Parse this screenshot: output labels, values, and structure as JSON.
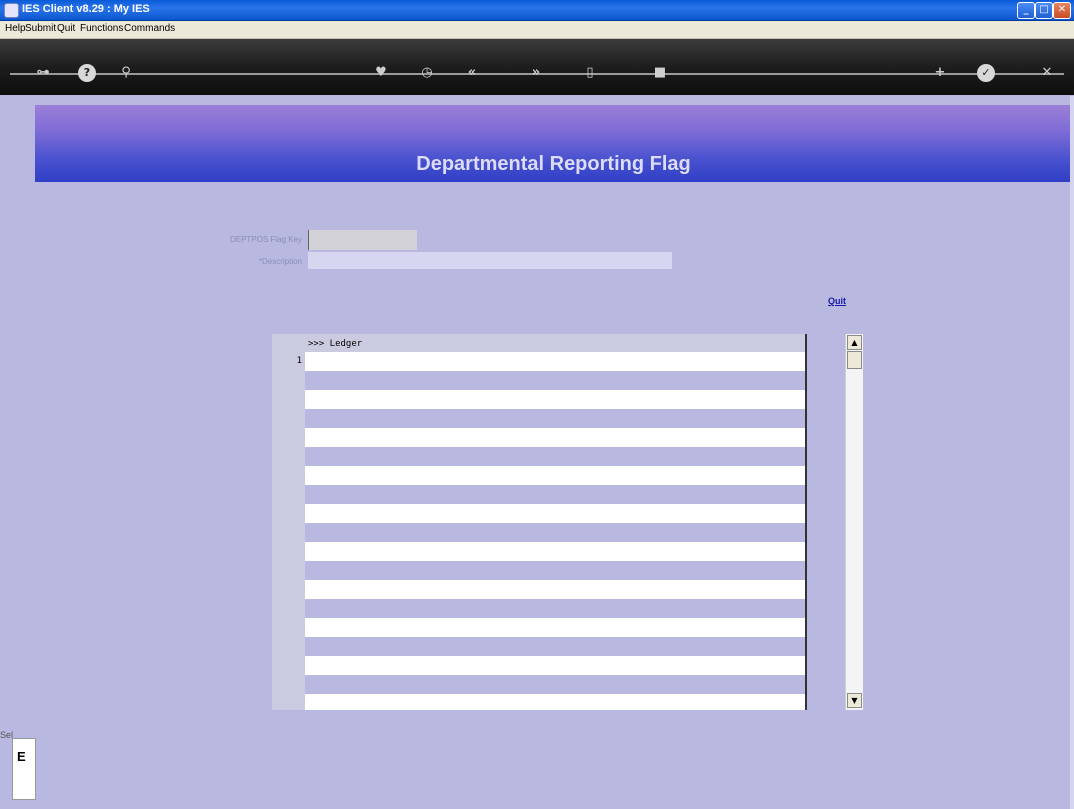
{
  "window": {
    "title": "IES Client v8.29 : My IES",
    "minimize": "_",
    "maximize": "□",
    "close": "✕"
  },
  "menu": {
    "items": [
      "Help",
      "Submit",
      "Quit",
      "Functions",
      "Commands"
    ]
  },
  "toolbar": {
    "icons": [
      {
        "name": "key-icon",
        "glyph": "⊶"
      },
      {
        "name": "help-icon",
        "glyph": "?"
      },
      {
        "name": "search-icon",
        "glyph": "⚲"
      },
      {
        "name": "heart-icon",
        "glyph": "♥"
      },
      {
        "name": "clock-icon",
        "glyph": "◷"
      },
      {
        "name": "rewind-icon",
        "glyph": "«"
      },
      {
        "name": "forward-icon",
        "glyph": "»"
      },
      {
        "name": "document-icon",
        "glyph": "▯"
      },
      {
        "name": "stop-icon",
        "glyph": "■"
      },
      {
        "name": "add-icon",
        "glyph": "+"
      },
      {
        "name": "check-icon",
        "glyph": "✓"
      },
      {
        "name": "cancel-icon",
        "glyph": "✕"
      }
    ]
  },
  "banner": {
    "title": "Departmental Reporting Flag"
  },
  "form": {
    "key_label": "DEPTPOS Flag Key",
    "key_value": "",
    "description_label": "*Description",
    "description_value": "",
    "quit_link": "Quit"
  },
  "grid": {
    "header": ">>> Ledger",
    "row_number": "1"
  },
  "footer": {
    "side_tab": "Sel",
    "side_letter": "E"
  },
  "colors": {
    "background": "#b8b8e0",
    "banner_top": "#9b7fd8",
    "banner_bottom": "#2f3fc6"
  }
}
